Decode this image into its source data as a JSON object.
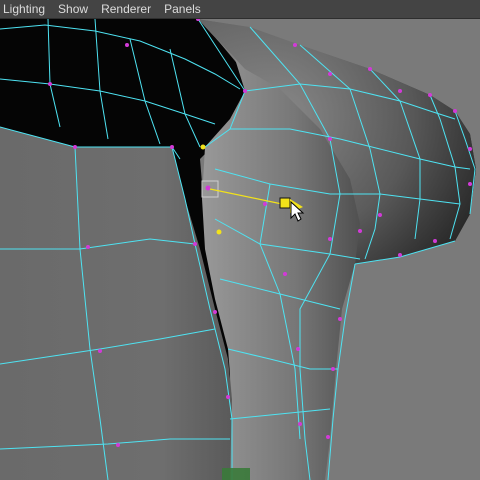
{
  "menubar": {
    "items": [
      {
        "label": "Lighting"
      },
      {
        "label": "Show"
      },
      {
        "label": "Renderer"
      },
      {
        "label": "Panels"
      }
    ]
  },
  "viewport": {
    "background_color": "#7a7a7a",
    "wireframe_color": "#4ee3f2",
    "vertex_color": "#d23ad8",
    "manipulator_color": "#f2e21a"
  }
}
